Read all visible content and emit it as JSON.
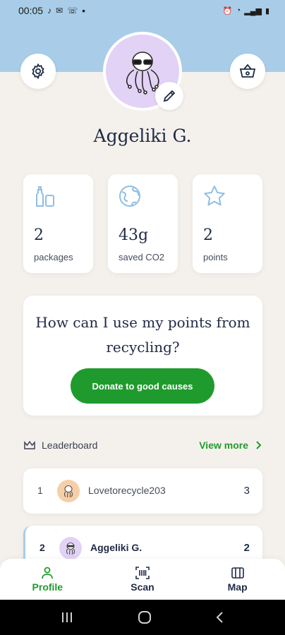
{
  "status_bar": {
    "time": "00:05",
    "dot": "•"
  },
  "profile": {
    "name": "Aggeliki G."
  },
  "stats": [
    {
      "value": "2",
      "label": "packages",
      "icon": "bottles-icon"
    },
    {
      "value": "43g",
      "label": "saved CO2",
      "icon": "globe-icon"
    },
    {
      "value": "2",
      "label": "points",
      "icon": "star-icon"
    }
  ],
  "points_card": {
    "question": "How can I use my points from recycling?",
    "donate_label": "Donate to good causes"
  },
  "leaderboard": {
    "title": "Leaderboard",
    "view_more": "View more",
    "rows": [
      {
        "rank": "1",
        "name": "Lovetorecycle203",
        "score": "3"
      },
      {
        "rank": "2",
        "name": "Aggeliki G.",
        "score": "2"
      }
    ]
  },
  "nav": {
    "profile": "Profile",
    "scan": "Scan",
    "map": "Map"
  },
  "colors": {
    "accent_green": "#1f9b2e",
    "sky_blue": "#a9cde8",
    "background": "#f4f1ec",
    "avatar_purple": "#e2d2f5"
  }
}
